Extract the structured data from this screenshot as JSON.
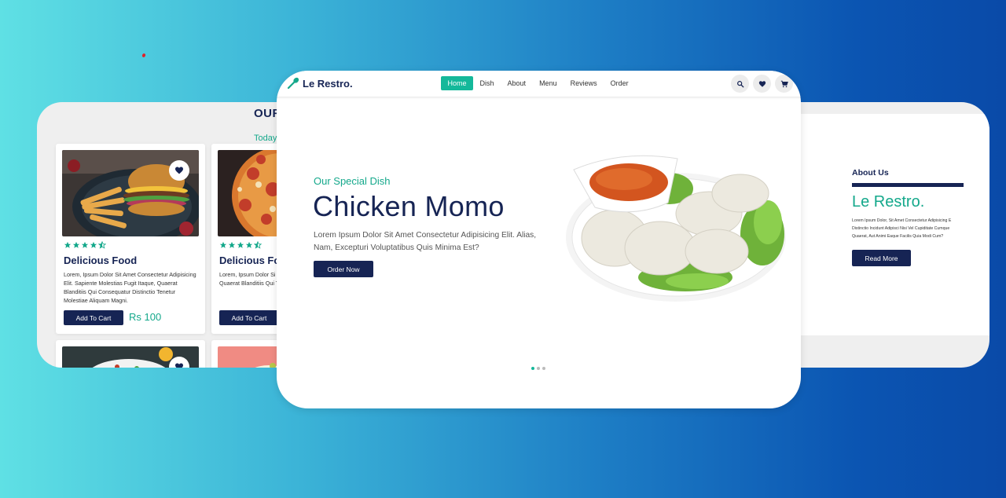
{
  "left_panel": {
    "title": "OUR",
    "subtitle": "Today'",
    "cards": [
      {
        "name": "Delicious Food",
        "desc": "Lorem, Ipsum Dolor Sit Amet Consectetur Adipisicing Elit. Sapiente Molestias Fugit Itaque, Quaerat Blanditiis Qui Consequatur Distinctio Tenetur Molestiae Aliquam Magni.",
        "button": "Add To Cart",
        "price": "Rs 100",
        "rating": 4.5
      },
      {
        "name": "Delicious Foo",
        "desc": "Lorem, Ipsum Dolor Si Adipisicing Elit. Sapien Quaerat Blanditiis Qui Tenetur Molestiae Ali",
        "button": "Add To Cart",
        "price": "",
        "rating": 4.5
      }
    ]
  },
  "navbar": {
    "brand": "Le Restro.",
    "links": [
      "Home",
      "Dish",
      "About",
      "Menu",
      "Reviews",
      "Order"
    ],
    "active": "Home",
    "icons": [
      "search-icon",
      "heart-icon",
      "cart-icon"
    ]
  },
  "hero": {
    "subtitle": "Our Special Dish",
    "title": "Chicken Momo",
    "description": "Lorem Ipsum Dolor Sit Amet Consectetur Adipisicing Elit. Alias, Nam, Excepturi Voluptatibus Quis Minima Est?",
    "button": "Order Now",
    "slide_count": 3,
    "active_slide": 1
  },
  "about": {
    "label": "About Us",
    "brand": "Le Restro.",
    "text_line1": "Lorem Ipsum Dolor, Sit Amet Consectetur Adipisicing E",
    "text_line2": "Distinctio Incidunt Adipisci Nisi Vel Cupiditate Cumque",
    "text_line3": "Quaerat, Aut Animi Eaque Facilis Quia Modi Cum?",
    "button": "Read More"
  },
  "colors": {
    "navy": "#162454",
    "teal": "#14a88b",
    "gradient_start": "#5fe0e4",
    "gradient_end": "#0a4aa8"
  }
}
